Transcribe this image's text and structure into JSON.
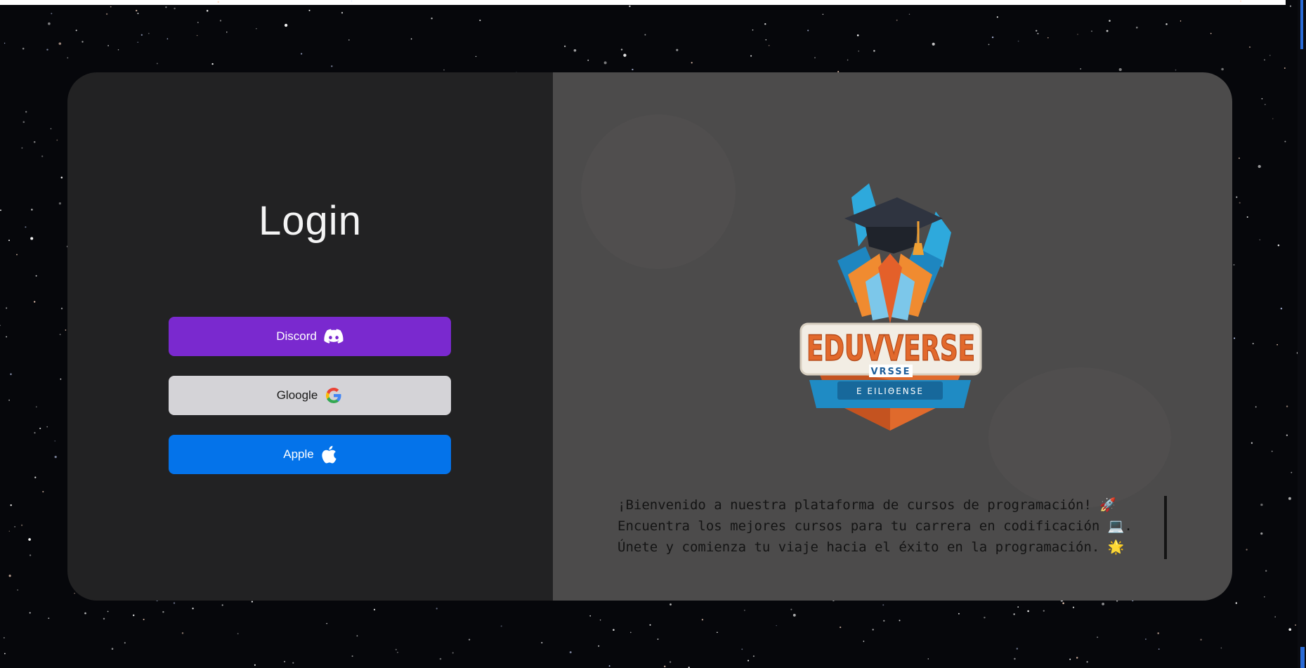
{
  "login": {
    "title": "Login",
    "buttons": {
      "discord_label": "Discord",
      "google_label": "Gloogle",
      "apple_label": "Apple"
    }
  },
  "brand": {
    "logo_text": "EDUVVERSE",
    "logo_subtext": "VRSSE",
    "logo_banner": "E EILIΘENSE"
  },
  "welcome": {
    "line1": "¡Bienvenido a nuestra plataforma de cursos de programación! 🚀",
    "line2": "Encuentra los mejores cursos para tu carrera en codificación 💻.",
    "line3": "Únete y comienza tu viaje hacia el éxito en la programación. 🌟"
  },
  "colors": {
    "discord": "#7a29cf",
    "google": "#d4d3d7",
    "apple": "#0473ea",
    "panel_left": "#222223",
    "panel_right": "#4c4b4b"
  },
  "icons": {
    "discord": "discord-icon",
    "google": "google-icon",
    "apple": "apple-icon"
  }
}
